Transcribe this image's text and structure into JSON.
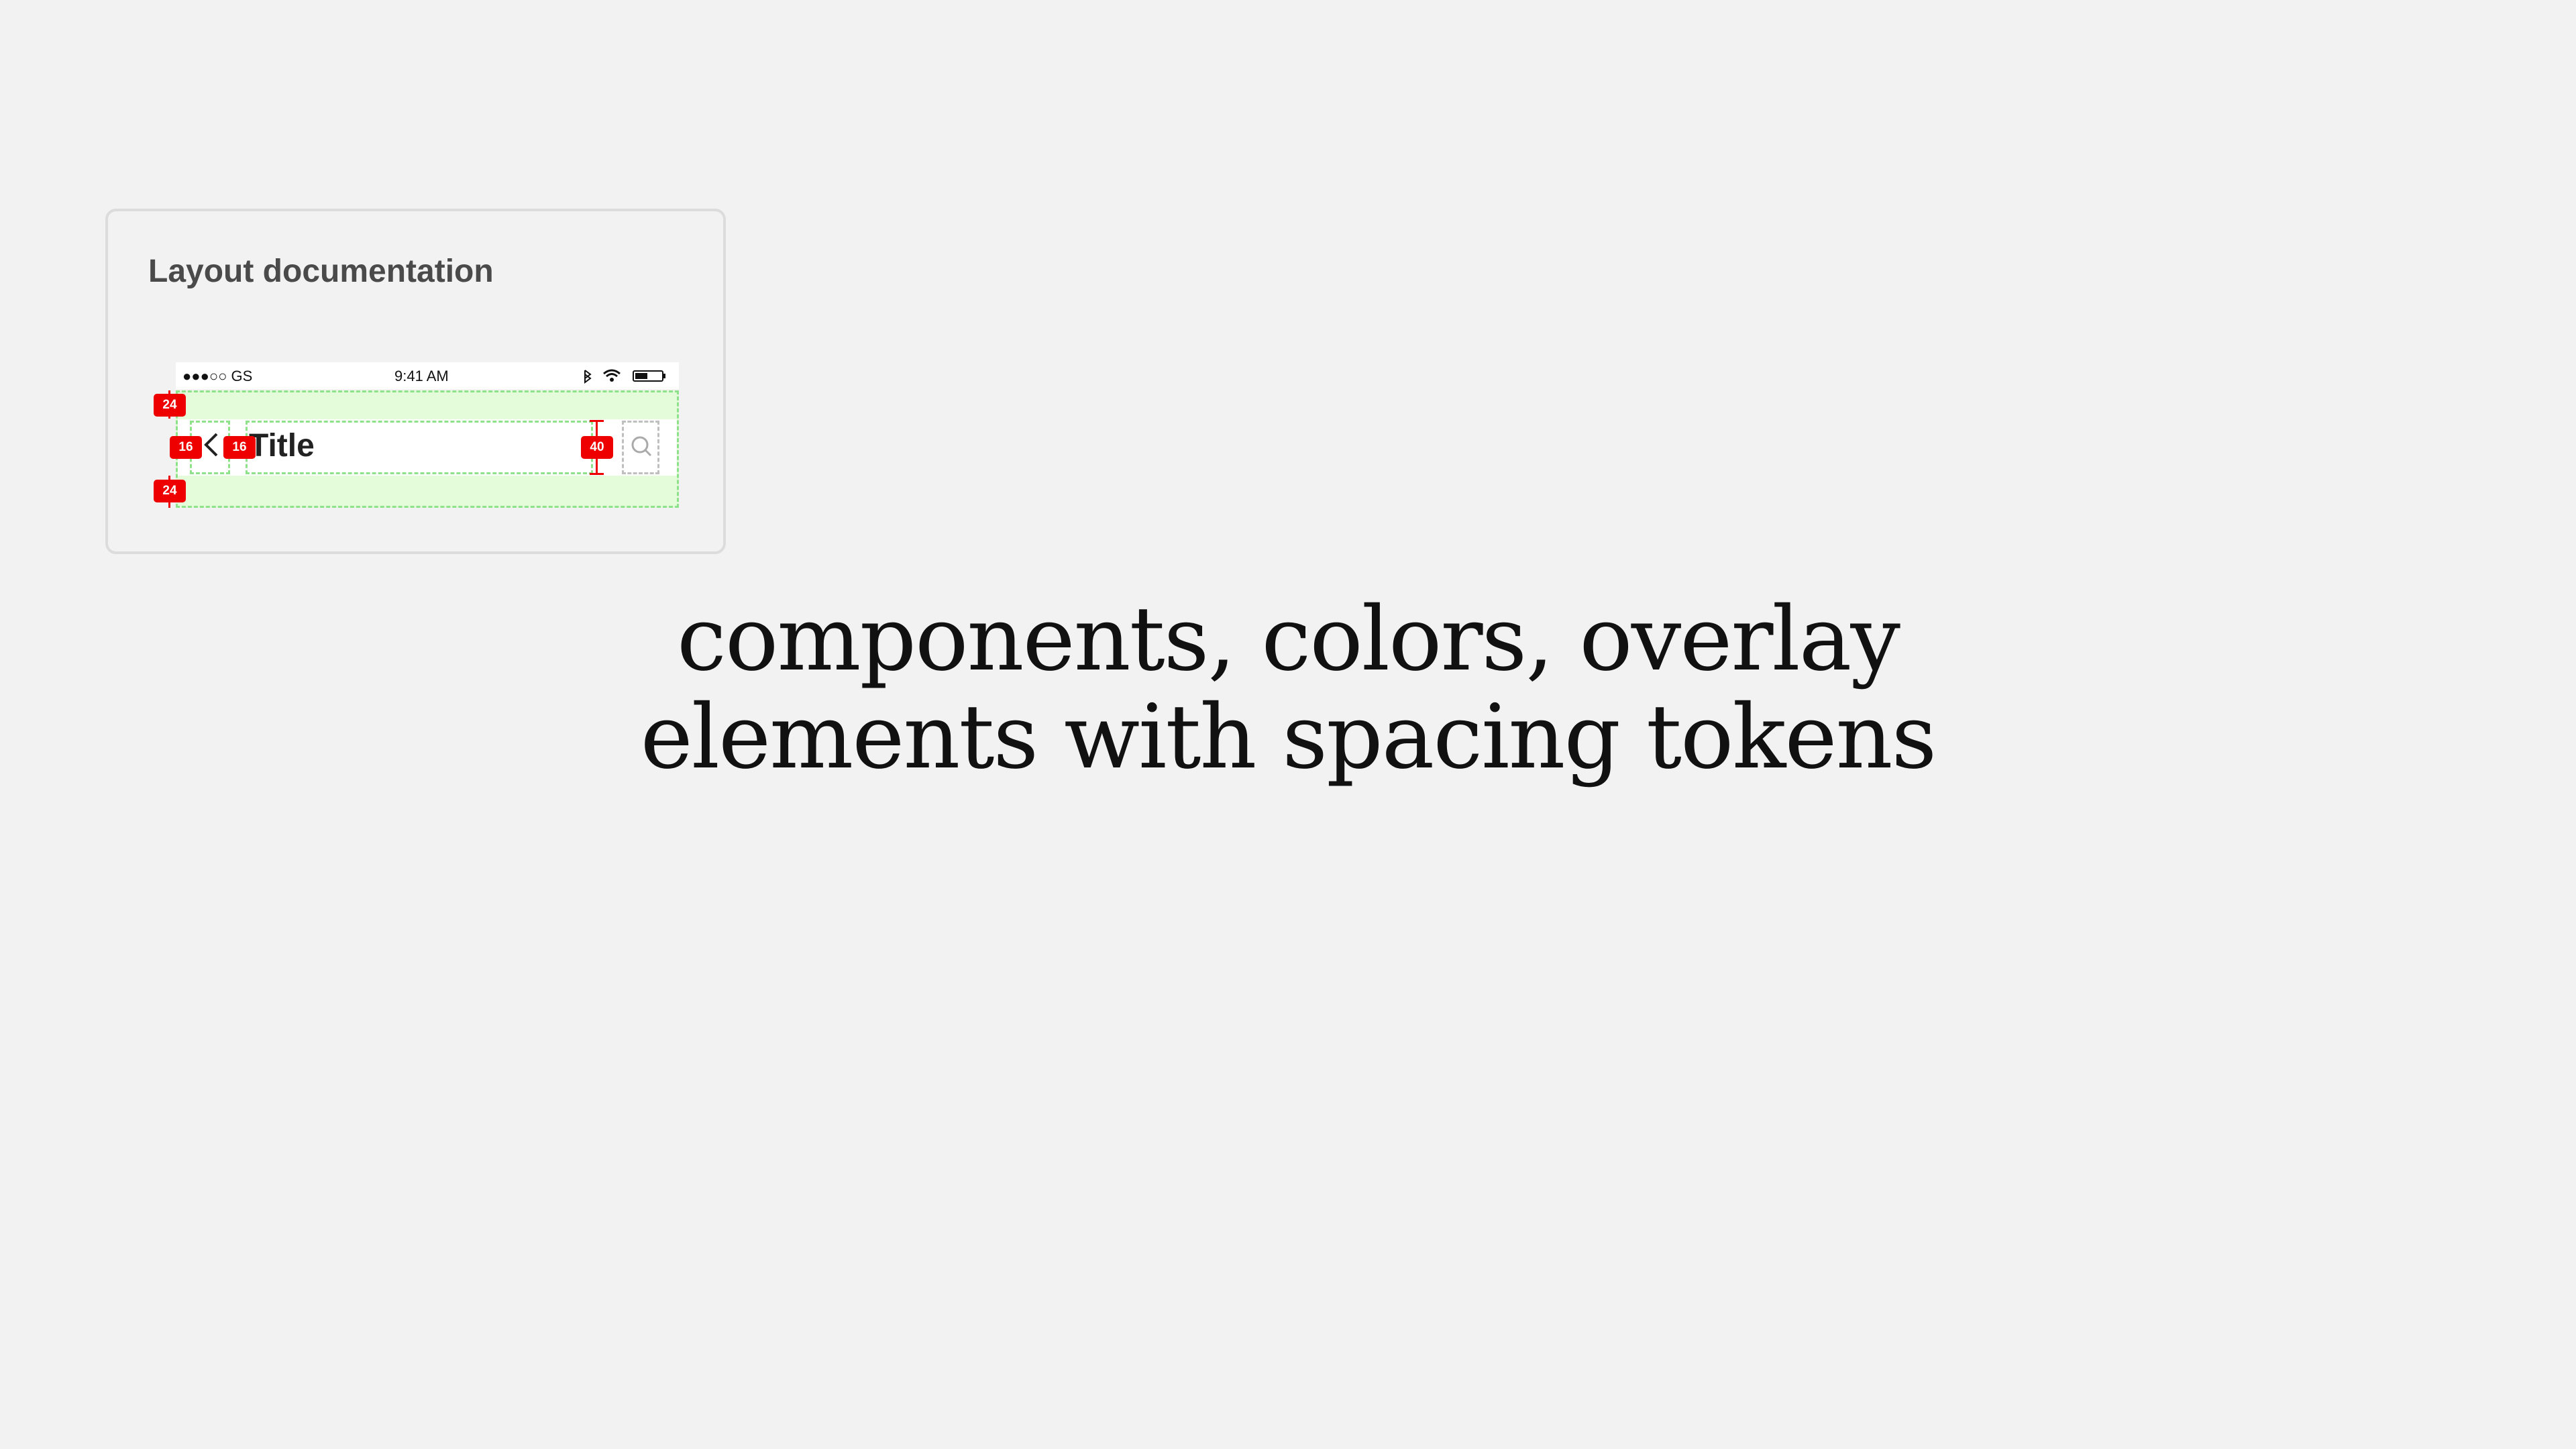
{
  "doc_card": {
    "title": "Layout documentation",
    "status_bar": {
      "carrier": "●●●○○ GS",
      "time": "9:41 AM"
    },
    "navbar": {
      "title": "Title"
    },
    "tokens": {
      "top": "24",
      "left_outer": "16",
      "left_inner": "16",
      "height": "40",
      "bottom": "24"
    },
    "icons": {
      "back": "chevron-left-icon",
      "action": "search-icon",
      "bluetooth": "bluetooth-icon",
      "wifi": "wifi-icon",
      "battery": "battery-icon"
    },
    "colors": {
      "frame_fill": "#e4fcd9",
      "frame_border": "#8ee28a",
      "token": "#ee0000"
    }
  },
  "headline": {
    "line1": "components, colors, overlay",
    "line2": "elements with spacing tokens"
  }
}
